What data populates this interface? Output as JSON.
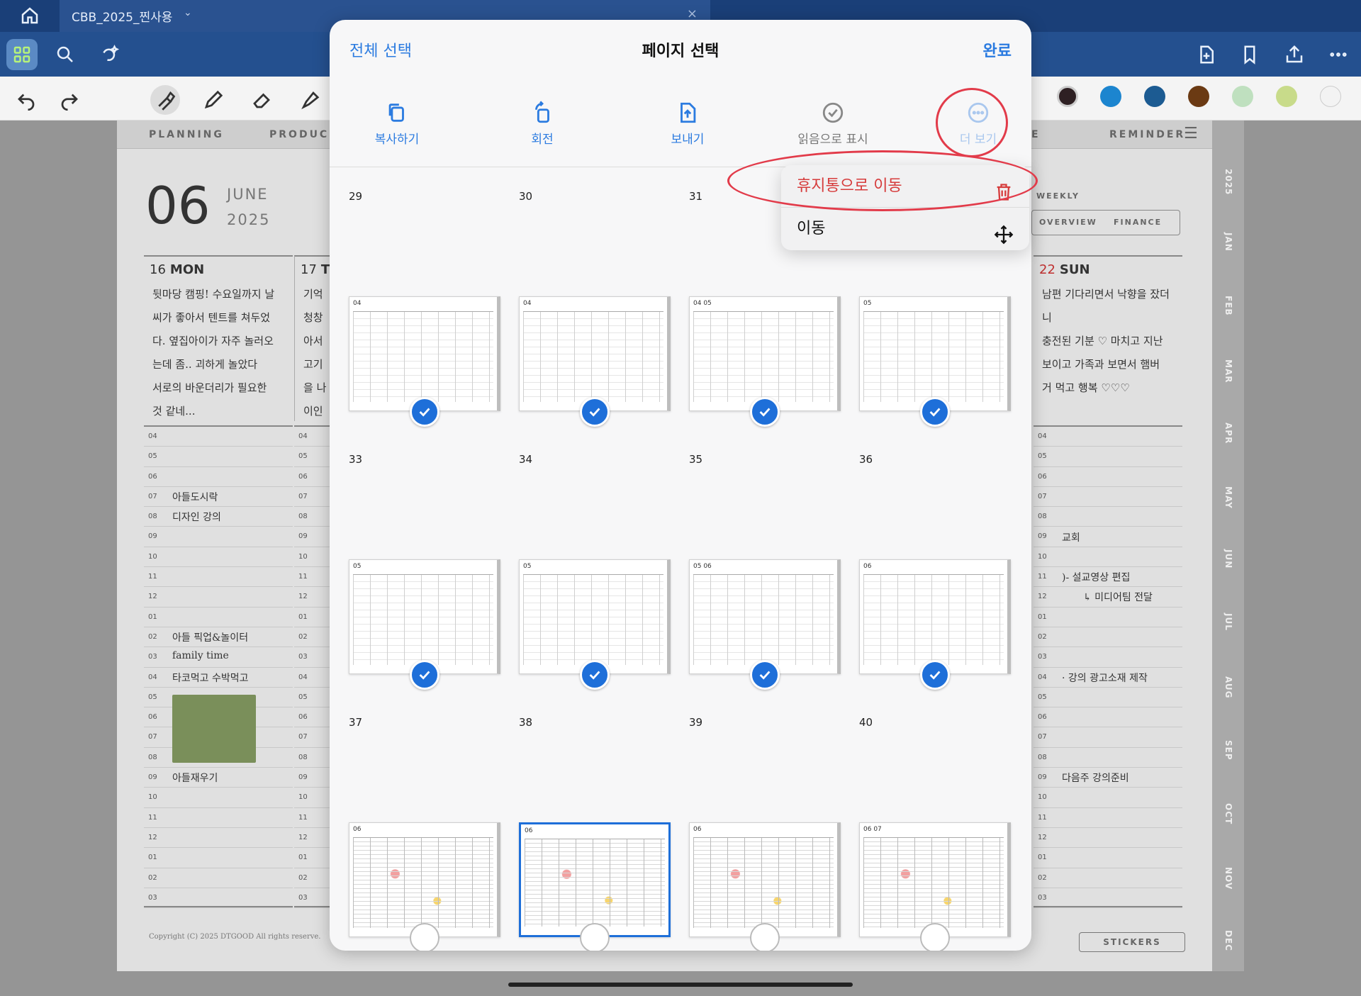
{
  "app": {
    "doc_tab": "CBB_2025_찐사용",
    "colors": {
      "accent": "#2b7be0",
      "danger": "#d63c3c",
      "annotation": "#e23b4a",
      "toolbar": "#24508f"
    }
  },
  "planner": {
    "tabs": [
      "PLANNING",
      "PRODUC",
      "E",
      "REMINDER"
    ],
    "date_num": "06",
    "month": "JUNE",
    "year": "2025",
    "weekly_label": "WEEKLY",
    "weekly_buttons": [
      "OVERVIEW",
      "FINANCE"
    ],
    "mon": {
      "num": "16",
      "name": "MON",
      "notes": [
        "뒷마당 캠핑! 수요일까지 날",
        "씨가 좋아서 텐트를 쳐두었",
        "다. 옆집아이가 자주 놀러오",
        "는데 좀.. 괴하게 놀았다",
        "서로의 바운더리가 필요한",
        "것 같네..."
      ]
    },
    "tue": {
      "num": "17",
      "name": "T",
      "notes": [
        "기억",
        "청창",
        "아서",
        "고기",
        "을 나",
        "이인"
      ]
    },
    "sun": {
      "num": "22",
      "name": "SUN",
      "notes": [
        "남편 기다리면서 낙향을 잤더니",
        "충전된 기분 ♡ 마치고 지난",
        "보이고 가족과 보면서 햄버",
        "거 먹고 행복 ♡♡♡"
      ]
    },
    "hours": [
      "04",
      "05",
      "06",
      "07",
      "08",
      "09",
      "10",
      "11",
      "12",
      "01",
      "02",
      "03",
      "04",
      "05",
      "06",
      "07",
      "08",
      "09",
      "10",
      "11",
      "12",
      "01",
      "02",
      "03"
    ],
    "mon_events": [
      {
        "text": "아들도시락",
        "row": 3
      },
      {
        "text": "디자인 강의",
        "row": 4
      },
      {
        "text": "아들 픽업&놀이터",
        "row": 10
      },
      {
        "text": "family time",
        "row": 11
      },
      {
        "text": "타코먹고 수박먹고",
        "row": 12
      },
      {
        "text": "아들재우기",
        "row": 17
      }
    ],
    "sun_events": [
      {
        "text": "교회",
        "row": 5
      },
      {
        "text": ")- 설교영상 편집",
        "row": 7
      },
      {
        "text": "↳ 미디어팀 전달",
        "row": 8
      },
      {
        "text": "· 강의 광고소재 제작",
        "row": 12
      },
      {
        "text": "다음주 강의준비",
        "row": 17
      }
    ],
    "months": [
      "2025",
      "JAN",
      "FEB",
      "MAR",
      "APR",
      "MAY",
      "JUN",
      "JUL",
      "AUG",
      "SEP",
      "OCT",
      "NOV",
      "DEC"
    ],
    "copyright": "Copyright (C) 2025 DTGOOD All rights reserve.",
    "stickers": "STICKERS"
  },
  "modal": {
    "select_all": "전체 선택",
    "title": "페이지 선택",
    "done": "완료",
    "actions": [
      {
        "label": "복사하기",
        "icon": "copy-icon",
        "state": "active"
      },
      {
        "label": "회전",
        "icon": "rotate-icon",
        "state": "active"
      },
      {
        "label": "보내기",
        "icon": "export-icon",
        "state": "active"
      },
      {
        "label": "읽음으로 표시",
        "icon": "check-circle-icon",
        "state": "disabled"
      },
      {
        "label": "더 보기",
        "icon": "more-icon",
        "state": "open"
      }
    ],
    "pages": [
      {
        "num": "29",
        "label": "04",
        "checked": true
      },
      {
        "num": "30",
        "label": "04",
        "checked": true
      },
      {
        "num": "31",
        "label": "04 05",
        "checked": true
      },
      {
        "num": "",
        "label": "05",
        "checked": true
      },
      {
        "num": "33",
        "label": "05",
        "checked": true
      },
      {
        "num": "34",
        "label": "05",
        "checked": true
      },
      {
        "num": "35",
        "label": "05 06",
        "checked": true
      },
      {
        "num": "36",
        "label": "06",
        "checked": true
      },
      {
        "num": "37",
        "label": "06",
        "checked": false
      },
      {
        "num": "38",
        "label": "06",
        "checked": false,
        "selected": true
      },
      {
        "num": "39",
        "label": "06",
        "checked": false
      },
      {
        "num": "40",
        "label": "06 07",
        "checked": false
      }
    ],
    "menu": {
      "trash": "휴지통으로 이동",
      "move": "이동"
    }
  }
}
